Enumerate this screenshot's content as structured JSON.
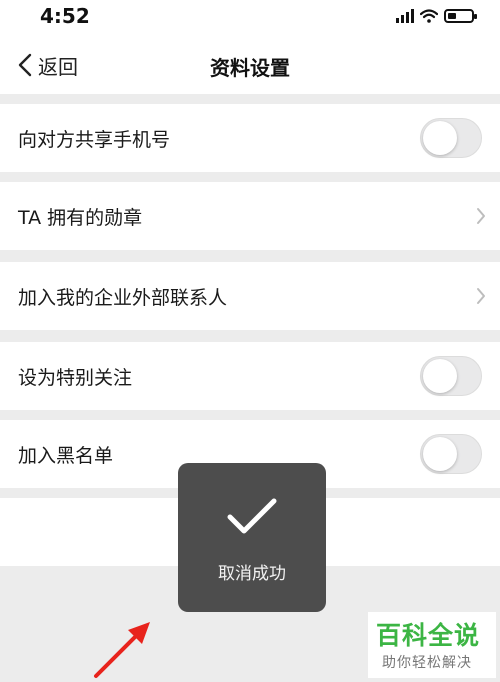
{
  "status_bar": {
    "time": "4:52"
  },
  "nav": {
    "back_label": "返回",
    "title": "资料设置"
  },
  "settings": [
    {
      "label": "向对方共享手机号",
      "control": "toggle",
      "on": false
    },
    {
      "label": "TA 拥有的勋章",
      "control": "chevron"
    },
    {
      "label": "加入我的企业外部联系人",
      "control": "chevron"
    },
    {
      "label": "设为特别关注",
      "control": "toggle",
      "on": false
    },
    {
      "label": "加入黑名单",
      "control": "toggle",
      "on": false
    }
  ],
  "toast": {
    "text": "取消成功",
    "icon": "checkmark-icon"
  },
  "watermark": {
    "title": "百科全说",
    "subtitle": "助你轻松解决"
  },
  "colors": {
    "watermark_green": "#3cb544",
    "arrow_red": "#e8231c",
    "toast_bg": "#4d4d4d"
  }
}
